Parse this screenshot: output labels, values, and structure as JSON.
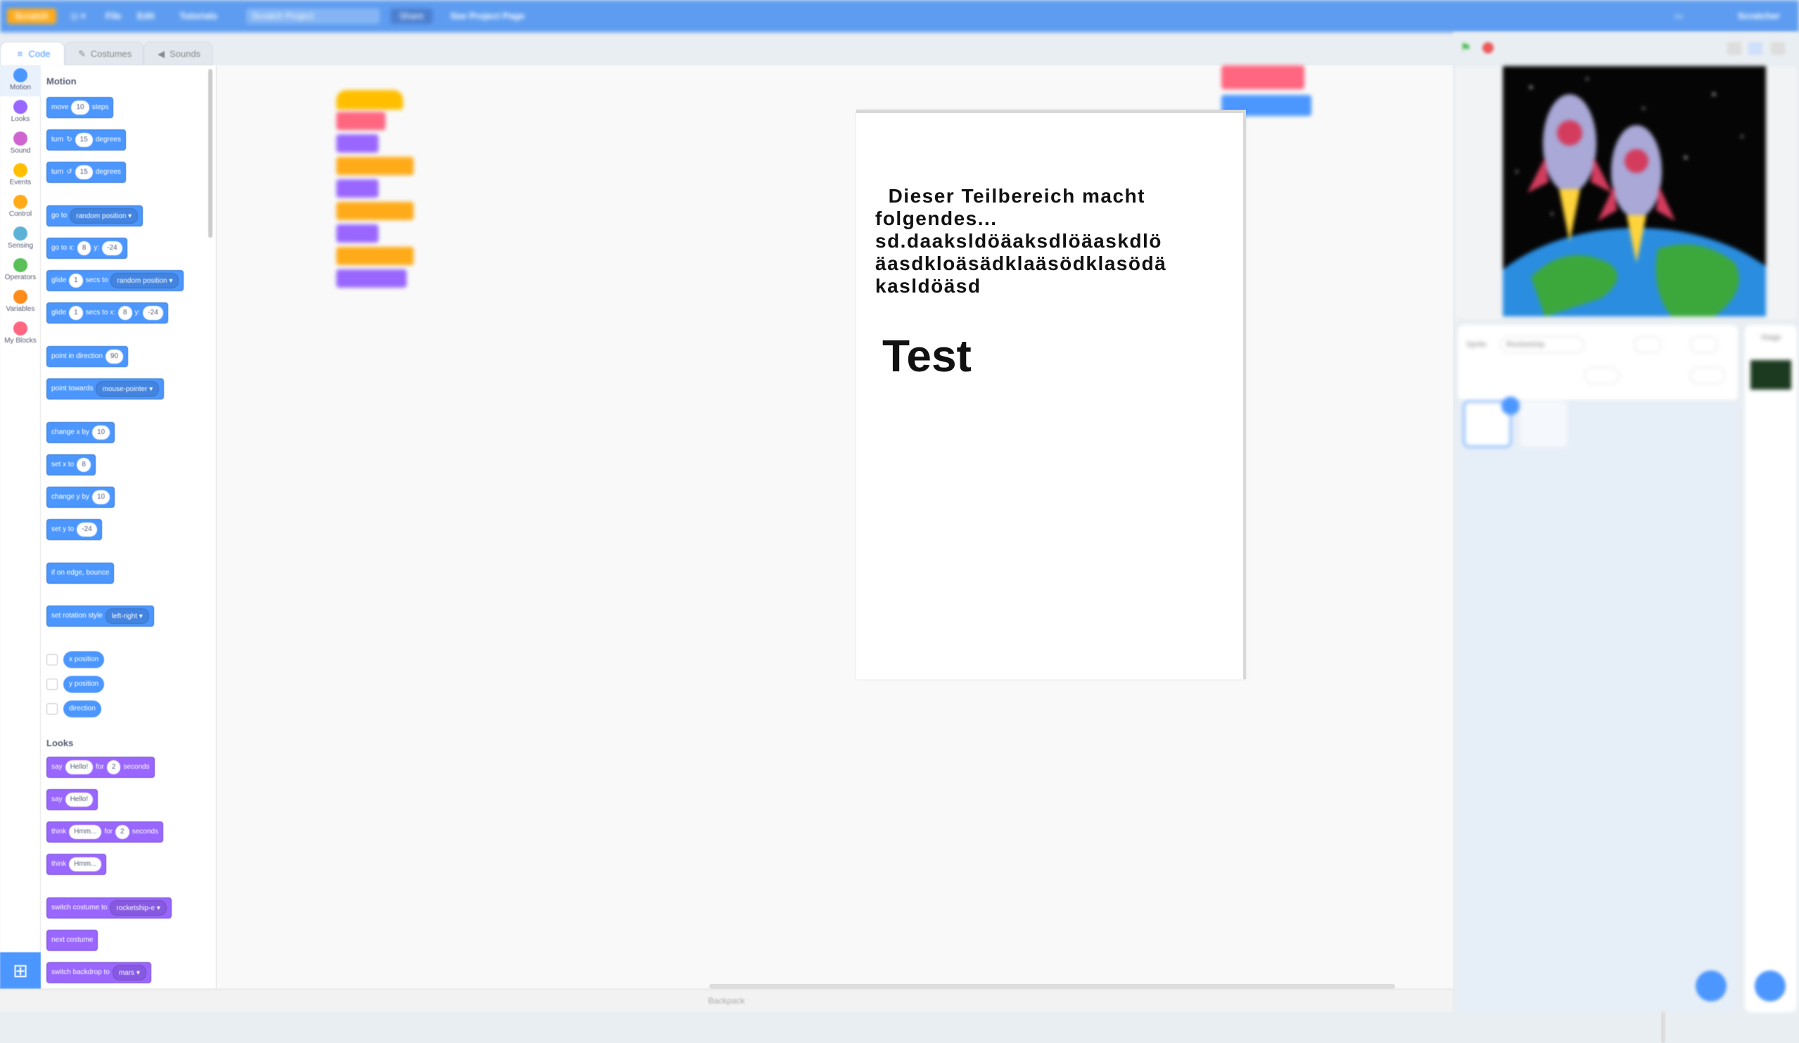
{
  "menubar": {
    "logo": "Scratch",
    "items": [
      "File",
      "Edit"
    ],
    "tutorials": "Tutorials",
    "project_title": "Scratch Project",
    "share": "Share",
    "see_project_page": "See Project Page",
    "username": "Scratcher"
  },
  "tabs": [
    {
      "label": "Code",
      "icon": "code-icon"
    },
    {
      "label": "Costumes",
      "icon": "brush-icon"
    },
    {
      "label": "Sounds",
      "icon": "speaker-icon"
    }
  ],
  "categories": [
    {
      "label": "Motion",
      "color": "#4c97ff"
    },
    {
      "label": "Looks",
      "color": "#9966ff"
    },
    {
      "label": "Sound",
      "color": "#cf63cf"
    },
    {
      "label": "Events",
      "color": "#ffbf00"
    },
    {
      "label": "Control",
      "color": "#ffab19"
    },
    {
      "label": "Sensing",
      "color": "#5cb1d6"
    },
    {
      "label": "Operators",
      "color": "#59c059"
    },
    {
      "label": "Variables",
      "color": "#ff8c1a"
    },
    {
      "label": "My Blocks",
      "color": "#ff6680"
    }
  ],
  "palette": {
    "motion_header": "Motion",
    "looks_header": "Looks",
    "move": {
      "a": "move",
      "v": "10",
      "b": "steps"
    },
    "turn_right": {
      "a": "turn",
      "v": "15",
      "b": "degrees"
    },
    "turn_left": {
      "a": "turn",
      "v": "15",
      "b": "degrees"
    },
    "goto": {
      "a": "go to",
      "dd": "random position"
    },
    "goto_xy": {
      "a": "go to x:",
      "x": "8",
      "b": "y:",
      "y": "-24"
    },
    "glide_to": {
      "a": "glide",
      "v": "1",
      "b": "secs to",
      "dd": "random position"
    },
    "glide_xy": {
      "a": "glide",
      "v": "1",
      "b": "secs to x:",
      "x": "8",
      "c": "y:",
      "y": "-24"
    },
    "point_dir": {
      "a": "point in direction",
      "v": "90"
    },
    "point_towards": {
      "a": "point towards",
      "dd": "mouse-pointer"
    },
    "change_x": {
      "a": "change x by",
      "v": "10"
    },
    "set_x": {
      "a": "set x to",
      "v": "8"
    },
    "change_y": {
      "a": "change y by",
      "v": "10"
    },
    "set_y": {
      "a": "set y to",
      "v": "-24"
    },
    "bounce": "if on edge, bounce",
    "rotation_style": {
      "a": "set rotation style",
      "dd": "left-right"
    },
    "reporters": [
      "x position",
      "y position",
      "direction"
    ],
    "say_for": {
      "a": "say",
      "v": "Hello!",
      "b": "for",
      "n": "2",
      "c": "seconds"
    },
    "say": {
      "a": "say",
      "v": "Hello!"
    },
    "think_for": {
      "a": "think",
      "v": "Hmm...",
      "b": "for",
      "n": "2",
      "c": "seconds"
    },
    "think": {
      "a": "think",
      "v": "Hmm..."
    },
    "switch_costume": {
      "a": "switch costume to",
      "dd": "rocketship-e"
    },
    "next_costume": "next costume",
    "switch_backdrop": {
      "a": "switch backdrop to",
      "dd": "mars"
    }
  },
  "popup": {
    "body": "  Dieser Teilbereich macht folgendes...\nsd.daaksldöäaksdlöäaskdlö äasdkloäsädklaäsödklasödä kasldöäsd",
    "heading": "Test"
  },
  "bottom": {
    "label": "Backpack"
  },
  "stage": {
    "sprite_label": "Sprite",
    "sprite_name": "Rocketship",
    "backdrop_label": "Stage"
  },
  "colors": {
    "accent": "#4c97ff",
    "menubar": "#5d9cf0"
  }
}
